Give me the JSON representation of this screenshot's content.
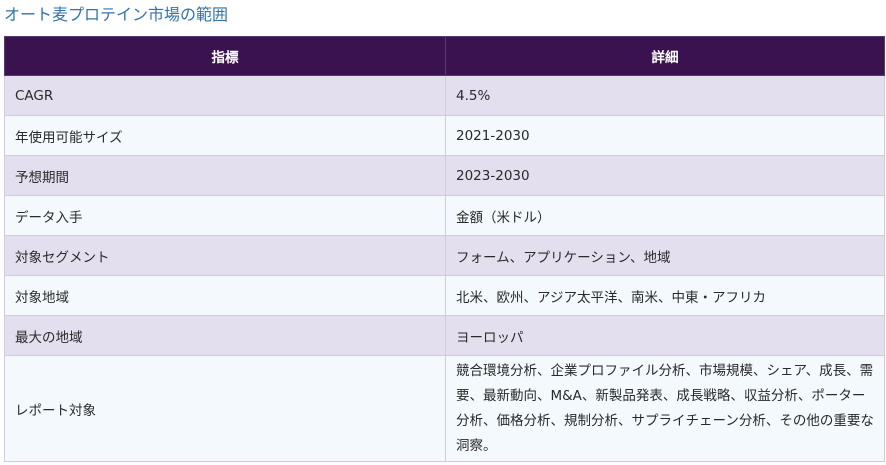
{
  "page": {
    "title": "オート麦プロテイン市場の範囲"
  },
  "table": {
    "headers": [
      "指標",
      "詳細"
    ],
    "rows": [
      {
        "label": "CAGR",
        "value": "4.5%"
      },
      {
        "label": "年使用可能サイズ",
        "value": "2021-2030"
      },
      {
        "label": "予想期間",
        "value": "2023-2030"
      },
      {
        "label": "データ入手",
        "value": "金額（米ドル）"
      },
      {
        "label": "対象セグメント",
        "value": "フォーム、アプリケーション、地域"
      },
      {
        "label": "対象地域",
        "value": "北米、欧州、アジア太平洋、南米、中東・アフリカ"
      },
      {
        "label": "最大の地域",
        "value": "ヨーロッパ"
      },
      {
        "label": "レポート対象",
        "value": "競合環境分析、企業プロファイル分析、市場規模、シェア、成長、需要、最新動向、M&A、新製品発表、成長戦略、収益分析、ポーター分析、価格分析、規制分析、サプライチェーン分析、その他の重要な洞察。"
      }
    ]
  },
  "colors": {
    "header_bg": "#3a1250",
    "title_text": "#2f73b0",
    "row_shade": "#e3dfee",
    "row_plain": "#f3f9fd"
  }
}
